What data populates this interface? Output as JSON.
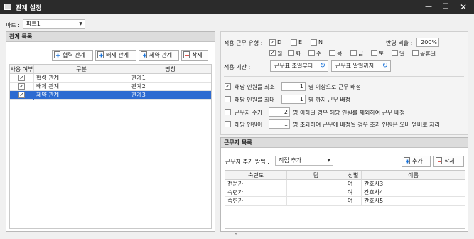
{
  "window": {
    "title": "관계 설정"
  },
  "part": {
    "label": "파트 :",
    "value": "파트1"
  },
  "left_panel": {
    "title": "관계 목록",
    "buttons": {
      "cooperate": "협력 관계",
      "exclude": "배제 관계",
      "restrict": "제약 관계",
      "delete": "삭제"
    },
    "columns": [
      "사용 여부",
      "구분",
      "명칭"
    ],
    "rows": [
      {
        "use": "✓",
        "type": "협력 관계",
        "name": "관계1"
      },
      {
        "use": "✓",
        "type": "배제 관계",
        "name": "관계2"
      },
      {
        "use": "✓",
        "type": "제약 관계",
        "name": "관계3"
      }
    ]
  },
  "settings": {
    "duty_type_label": "적용 근무 유형 :",
    "duties": [
      {
        "label": "D",
        "checked": true
      },
      {
        "label": "E",
        "checked": false
      },
      {
        "label": "N",
        "checked": false
      }
    ],
    "ratio_label": "반영 비율 :",
    "ratio_value": "200%",
    "days": [
      {
        "label": "월",
        "checked": true
      },
      {
        "label": "화",
        "checked": false
      },
      {
        "label": "수",
        "checked": false
      },
      {
        "label": "목",
        "checked": false
      },
      {
        "label": "금",
        "checked": false
      },
      {
        "label": "토",
        "checked": false
      },
      {
        "label": "일",
        "checked": false
      },
      {
        "label": "공휴일",
        "checked": false
      }
    ],
    "period_label": "적용 기간 :",
    "period_start": "근무표 초일부터",
    "period_end": "근무표 말일까지",
    "rules": [
      {
        "checked": true,
        "pre": "해당 인원를 최소",
        "value": "1",
        "post": "명 이상으로 근무 배정"
      },
      {
        "checked": false,
        "pre": "해당 인원를 최대",
        "value": "1",
        "post": "명 까지 근무 배정"
      },
      {
        "checked": false,
        "pre": "근무자 수가",
        "value": "2",
        "post": "명 이하일 경우 해당 인원를 제외하여 근무 배정"
      },
      {
        "checked": false,
        "pre": "해당 인원이",
        "value": "1",
        "post": "명 초과하여 근무에 배정될 경우 초과 인원은 오버 멤버로 처리"
      }
    ]
  },
  "workers_panel": {
    "title": "근무자 목록",
    "method_label": "근무자 추가 방법 :",
    "method_value": "직접 추가",
    "add_button": "추가",
    "delete_button": "삭제",
    "columns": [
      "숙련도",
      "팀",
      "성별",
      "이름"
    ],
    "rows": [
      {
        "skill": "전문가",
        "team": "",
        "gender": "여",
        "name": "간호사3"
      },
      {
        "skill": "숙련가",
        "team": "",
        "gender": "여",
        "name": "간호사4"
      },
      {
        "skill": "숙련가",
        "team": "",
        "gender": "여",
        "name": "간호사5"
      }
    ]
  }
}
